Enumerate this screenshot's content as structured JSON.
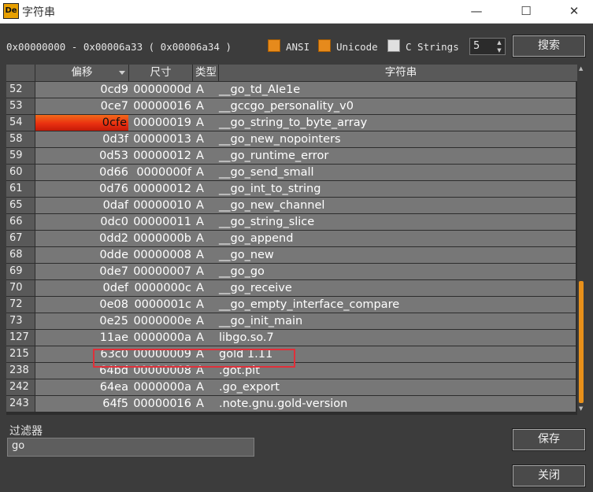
{
  "window": {
    "app_icon_text": "De",
    "title": "字符串",
    "min_glyph": "—",
    "max_glyph": "☐",
    "close_glyph": "✕"
  },
  "toolbar": {
    "range_text": "0x00000000 - 0x00006a33 ( 0x00006a34 )",
    "ansi_label": "ANSI",
    "ansi_checked": true,
    "unicode_label": "Unicode",
    "unicode_checked": true,
    "cstrings_label": "C Strings",
    "cstrings_checked": false,
    "min_length": "5",
    "search_label": "搜索",
    "accent_color": "#e68a1c"
  },
  "table": {
    "columns": [
      "",
      "偏移",
      "尺寸",
      "类型",
      "字符串"
    ],
    "selected_row_index": 2,
    "highlighted_row_index": 16,
    "rows": [
      {
        "idx": "52",
        "offset": "0cd9",
        "size": "0000000d",
        "type": "A",
        "string": "__go_td_AIe1e"
      },
      {
        "idx": "53",
        "offset": "0ce7",
        "size": "00000016",
        "type": "A",
        "string": "__gccgo_personality_v0"
      },
      {
        "idx": "54",
        "offset": "0cfe",
        "size": "00000019",
        "type": "A",
        "string": "__go_string_to_byte_array"
      },
      {
        "idx": "58",
        "offset": "0d3f",
        "size": "00000013",
        "type": "A",
        "string": "__go_new_nopointers"
      },
      {
        "idx": "59",
        "offset": "0d53",
        "size": "00000012",
        "type": "A",
        "string": "__go_runtime_error"
      },
      {
        "idx": "60",
        "offset": "0d66",
        "size": "0000000f",
        "type": "A",
        "string": "__go_send_small"
      },
      {
        "idx": "61",
        "offset": "0d76",
        "size": "00000012",
        "type": "A",
        "string": "__go_int_to_string"
      },
      {
        "idx": "65",
        "offset": "0daf",
        "size": "00000010",
        "type": "A",
        "string": "__go_new_channel"
      },
      {
        "idx": "66",
        "offset": "0dc0",
        "size": "00000011",
        "type": "A",
        "string": "__go_string_slice"
      },
      {
        "idx": "67",
        "offset": "0dd2",
        "size": "0000000b",
        "type": "A",
        "string": "__go_append"
      },
      {
        "idx": "68",
        "offset": "0dde",
        "size": "00000008",
        "type": "A",
        "string": "__go_new"
      },
      {
        "idx": "69",
        "offset": "0de7",
        "size": "00000007",
        "type": "A",
        "string": "__go_go"
      },
      {
        "idx": "70",
        "offset": "0def",
        "size": "0000000c",
        "type": "A",
        "string": "__go_receive"
      },
      {
        "idx": "72",
        "offset": "0e08",
        "size": "0000001c",
        "type": "A",
        "string": "__go_empty_interface_compare"
      },
      {
        "idx": "73",
        "offset": "0e25",
        "size": "0000000e",
        "type": "A",
        "string": "__go_init_main"
      },
      {
        "idx": "127",
        "offset": "11ae",
        "size": "0000000a",
        "type": "A",
        "string": "libgo.so.7"
      },
      {
        "idx": "215",
        "offset": "63c0",
        "size": "00000009",
        "type": "A",
        "string": "gold 1.11"
      },
      {
        "idx": "238",
        "offset": "64bd",
        "size": "00000008",
        "type": "A",
        "string": ".got.plt"
      },
      {
        "idx": "242",
        "offset": "64ea",
        "size": "0000000a",
        "type": "A",
        "string": ".go_export"
      },
      {
        "idx": "243",
        "offset": "64f5",
        "size": "00000016",
        "type": "A",
        "string": ".note.gnu.gold-version"
      }
    ]
  },
  "filter": {
    "label": "过滤器",
    "value": "go"
  },
  "buttons": {
    "save_label": "保存",
    "close_label": "关闭"
  }
}
